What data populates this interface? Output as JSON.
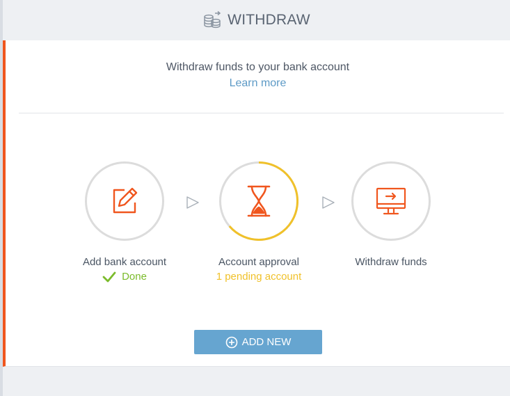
{
  "header": {
    "title": "WITHDRAW",
    "icon": "coins-icon"
  },
  "intro": {
    "text": "Withdraw funds to your bank account",
    "link": "Learn more"
  },
  "steps": [
    {
      "label": "Add bank account",
      "status": "Done",
      "icon": "edit-icon",
      "state": "done"
    },
    {
      "label": "Account approval",
      "status": "1 pending account",
      "icon": "hourglass-icon",
      "state": "pending"
    },
    {
      "label": "Withdraw funds",
      "status": "",
      "icon": "monitor-arrow-icon",
      "state": "todo"
    }
  ],
  "add_button": {
    "label": "ADD NEW",
    "icon": "plus-circle-icon"
  },
  "colors": {
    "accent": "#f0561e",
    "done": "#7bbb2b",
    "pending": "#f0c12a",
    "link": "#5d9ac6",
    "button": "#66a5d0"
  }
}
